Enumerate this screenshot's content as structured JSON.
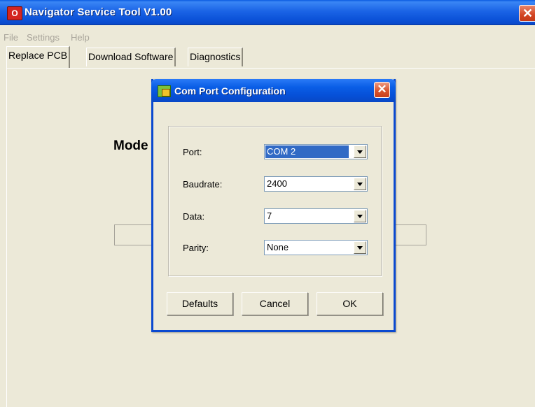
{
  "main_window": {
    "app_icon_text": "O",
    "title": "Navigator Service Tool V1.00",
    "close_glyph": "✕"
  },
  "menu": [
    "File",
    "Settings",
    "Help"
  ],
  "tabs": [
    "Replace PCB",
    "Download Software",
    "Diagnostics"
  ],
  "active_tab": "Replace PCB",
  "panel": {
    "model_label": "Mode"
  },
  "dialog": {
    "title": "Com Port Configuration",
    "close_glyph": "✕",
    "fields": [
      {
        "label": "Port:",
        "value": "COM 2",
        "selected": true
      },
      {
        "label": "Baudrate:",
        "value": "2400"
      },
      {
        "label": "Data:",
        "value": "7"
      },
      {
        "label": "Parity:",
        "value": "None"
      }
    ],
    "buttons": {
      "defaults": "Defaults",
      "cancel": "Cancel",
      "ok": "OK"
    }
  },
  "colors": {
    "titlebar": "#0a5ce0",
    "close": "#d34523",
    "selection": "#316ac5",
    "face": "#ece9d8"
  },
  "icons": {
    "app": "ohaus-logo-icon",
    "dialog": "port-config-icon",
    "close": "close-icon",
    "dropdown": "chevron-down-icon"
  }
}
